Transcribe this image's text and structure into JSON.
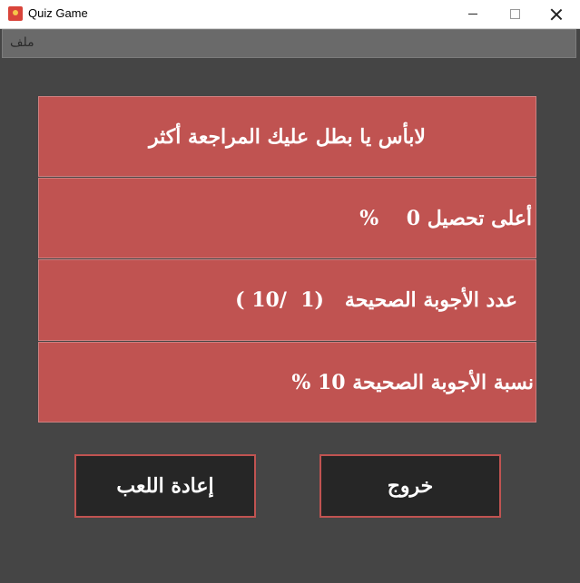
{
  "window": {
    "title": "Quiz Game"
  },
  "menu": {
    "file_label": "ملف"
  },
  "results": {
    "message": "لابأس يا بطل عليك المراجعة أكثر",
    "highest_score": "أعلى تحصيل 0    %",
    "correct_count": "عدد الأجوبة الصحيحة   (1  /10 )",
    "correct_percent": "نسبة الأجوبة الصحيحة 10 %"
  },
  "buttons": {
    "replay_label": "إعادة اللعب",
    "exit_label": "خروج"
  },
  "colors": {
    "panel": "#c05351",
    "background": "#454545",
    "button": "#262626"
  }
}
